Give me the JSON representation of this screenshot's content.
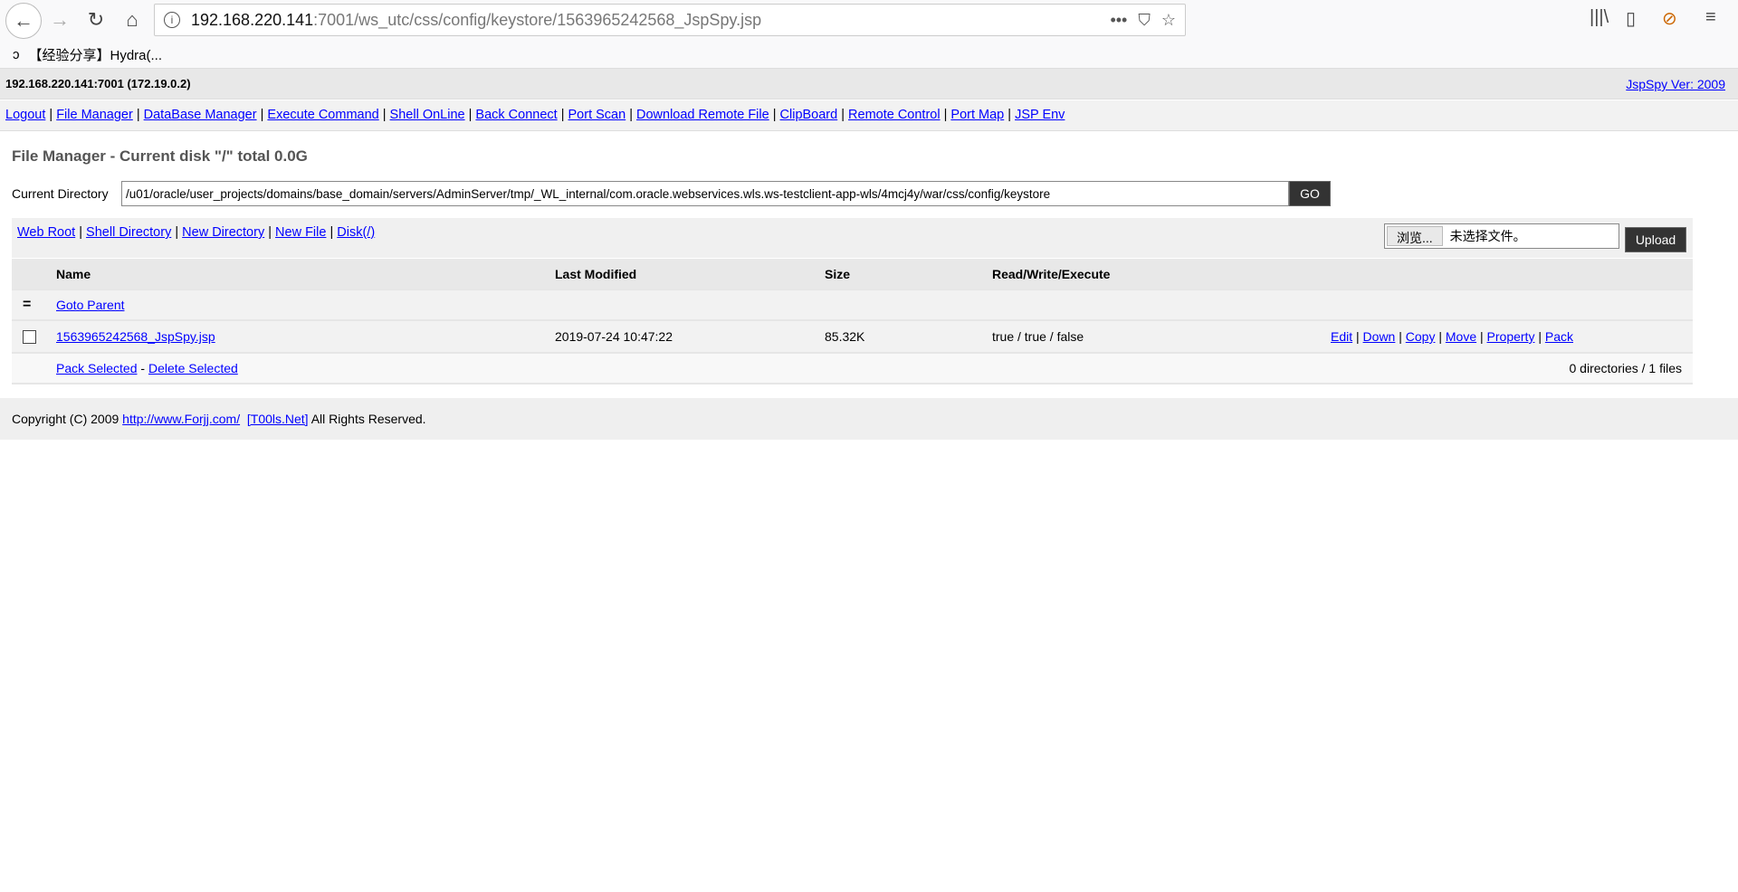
{
  "browser": {
    "url_host": "192.168.220.141",
    "url_path": ":7001/ws_utc/css/config/keystore/1563965242568_JspSpy.jsp",
    "bookmark": "【经验分享】Hydra(...",
    "icons": [
      "back-icon",
      "forward-icon",
      "reload-icon",
      "home-icon",
      "info-icon",
      "more-icon",
      "pocket-icon",
      "star-icon",
      "library-icon",
      "sidebar-icon",
      "extension-icon",
      "menu-icon"
    ]
  },
  "header": {
    "host": "192.168.220.141:7001 (172.19.0.2)",
    "version": "JspSpy Ver: 2009"
  },
  "nav": [
    "Logout",
    "File Manager",
    "DataBase Manager",
    "Execute Command",
    "Shell OnLine",
    "Back Connect",
    "Port Scan",
    "Download Remote File",
    "ClipBoard",
    "Remote Control",
    "Port Map",
    "JSP Env"
  ],
  "title": "File Manager - Current disk \"/\" total 0.0G",
  "current_dir": {
    "label": "Current Directory",
    "value": "/u01/oracle/user_projects/domains/base_domain/servers/AdminServer/tmp/_WL_internal/com.oracle.webservices.wls.ws-testclient-app-wls/4mcj4y/war/css/config/keystore",
    "go": "GO"
  },
  "tools": [
    "Web Root",
    "Shell Directory",
    "New Directory",
    "New File",
    "Disk(/)"
  ],
  "upload": {
    "browse": "浏览...",
    "no_file": "未选择文件。",
    "button": "Upload"
  },
  "table": {
    "headers": [
      "Name",
      "Last Modified",
      "Size",
      "Read/Write/Execute"
    ],
    "parent_icon": "=",
    "parent": "Goto Parent",
    "files": [
      {
        "name": "1563965242568_JspSpy.jsp",
        "modified": "2019-07-24 10:47:22",
        "size": "85.32K",
        "rwx": "true / true / false",
        "actions": [
          "Edit",
          "Down",
          "Copy",
          "Move",
          "Property",
          "Pack"
        ]
      }
    ],
    "pack_selected": "Pack Selected",
    "sep": "-",
    "delete_selected": "Delete Selected",
    "summary": "0 directories / 1 files"
  },
  "footer": {
    "prefix": "Copyright (C) 2009",
    "link1": "http://www.Forjj.com/",
    "link2": "[T00ls.Net]",
    "suffix": "All Rights Reserved."
  }
}
